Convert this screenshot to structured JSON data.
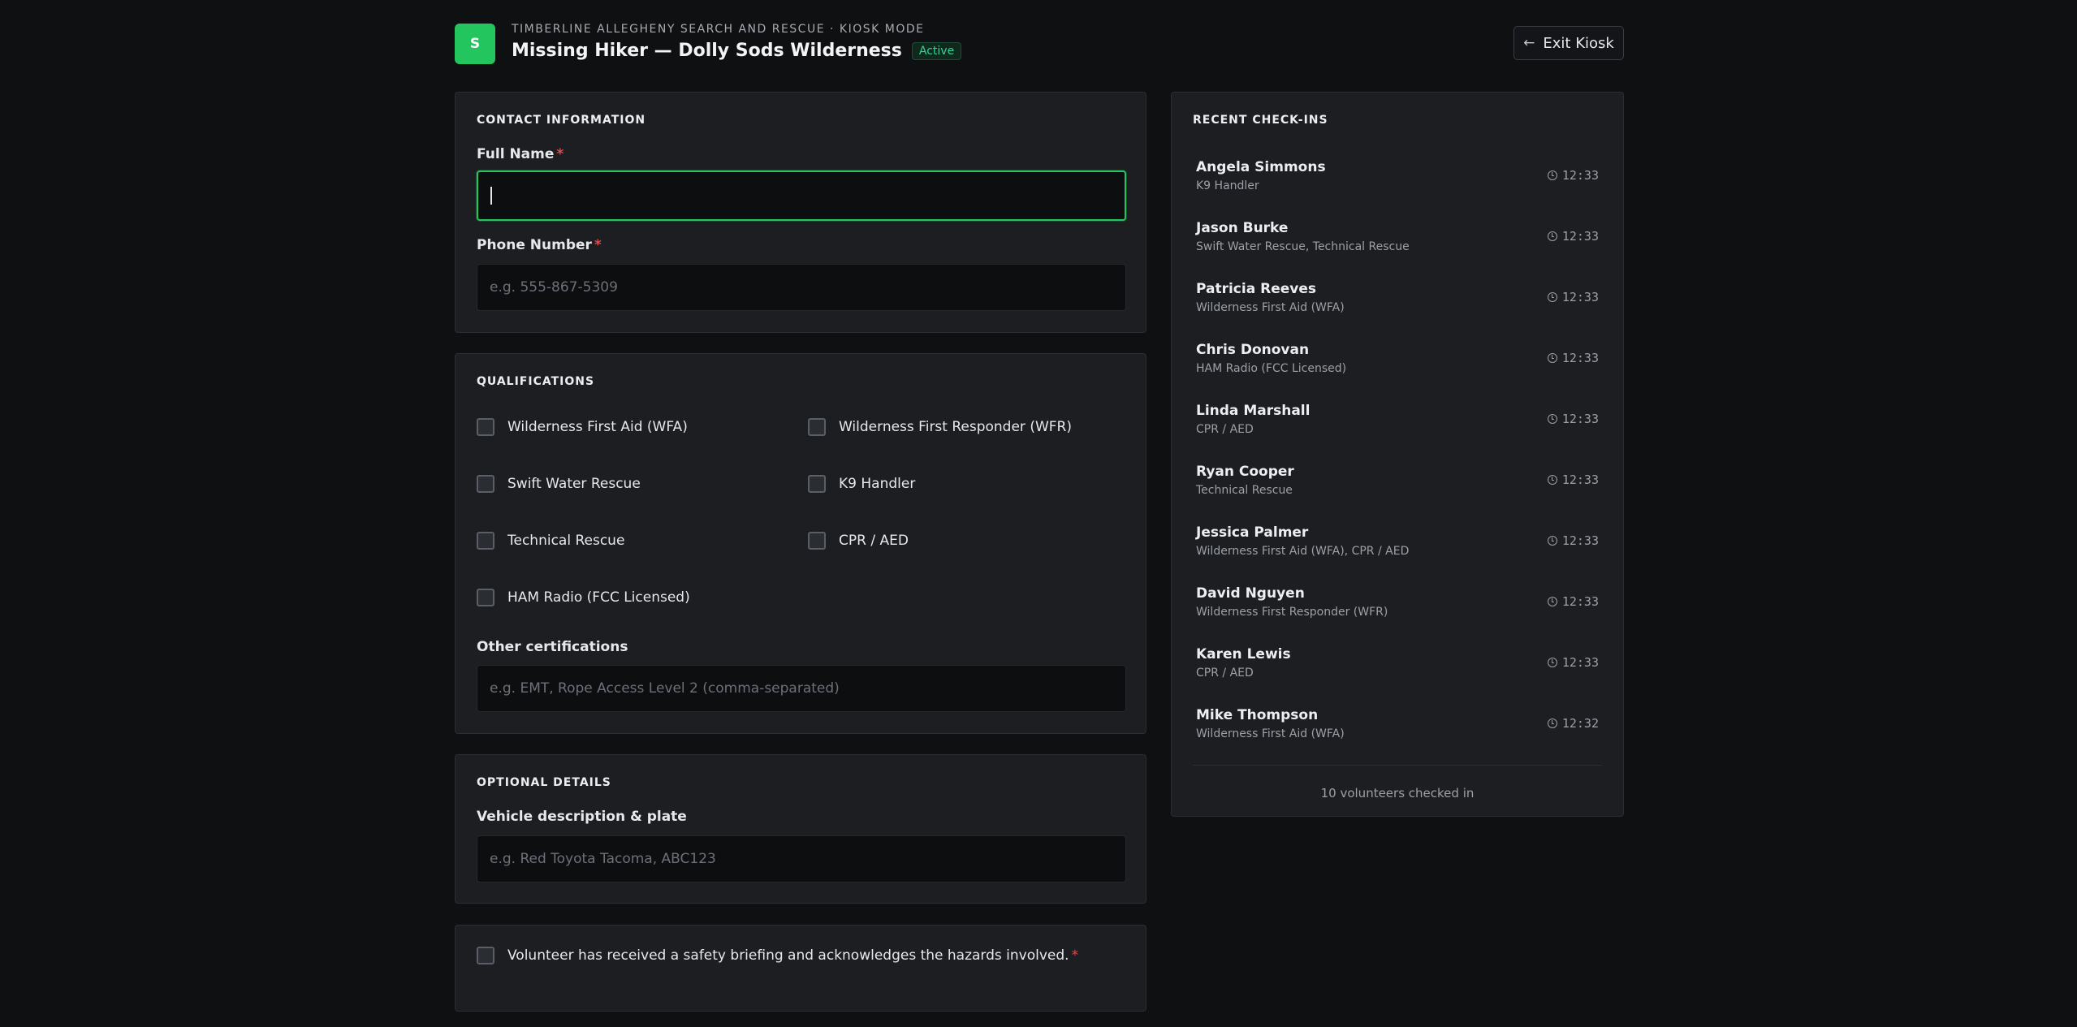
{
  "header": {
    "logo_letter": "S",
    "org": "TIMBERLINE ALLEGHENY SEARCH AND RESCUE · KIOSK MODE",
    "title": "Missing Hiker — Dolly Sods Wilderness",
    "status": "Active",
    "exit_label": "Exit Kiosk"
  },
  "contact": {
    "section_title": "CONTACT INFORMATION",
    "full_name_label": "Full Name",
    "full_name_value": "",
    "phone_label": "Phone Number",
    "phone_placeholder": "e.g. 555-867-5309",
    "required_mark": "*"
  },
  "qualifications": {
    "section_title": "QUALIFICATIONS",
    "items": [
      {
        "label": "Wilderness First Aid (WFA)",
        "checked": false
      },
      {
        "label": "Wilderness First Responder (WFR)",
        "checked": false
      },
      {
        "label": "Swift Water Rescue",
        "checked": false
      },
      {
        "label": "K9 Handler",
        "checked": false
      },
      {
        "label": "Technical Rescue",
        "checked": false
      },
      {
        "label": "CPR / AED",
        "checked": false
      },
      {
        "label": "HAM Radio (FCC Licensed)",
        "checked": false
      }
    ],
    "other_label": "Other certifications",
    "other_placeholder": "e.g. EMT, Rope Access Level 2 (comma-separated)"
  },
  "optional": {
    "section_title": "OPTIONAL DETAILS",
    "vehicle_label": "Vehicle description & plate",
    "vehicle_placeholder": "e.g. Red Toyota Tacoma, ABC123"
  },
  "briefing": {
    "label": "Volunteer has received a safety briefing and acknowledges the hazards involved.",
    "required_mark": "*",
    "checked": false
  },
  "checkins": {
    "section_title": "RECENT CHECK-INS",
    "items": [
      {
        "name": "Angela Simmons",
        "quals": "K9 Handler",
        "time": "12:33"
      },
      {
        "name": "Jason Burke",
        "quals": "Swift Water Rescue, Technical Rescue",
        "time": "12:33"
      },
      {
        "name": "Patricia Reeves",
        "quals": "Wilderness First Aid (WFA)",
        "time": "12:33"
      },
      {
        "name": "Chris Donovan",
        "quals": "HAM Radio (FCC Licensed)",
        "time": "12:33"
      },
      {
        "name": "Linda Marshall",
        "quals": "CPR / AED",
        "time": "12:33"
      },
      {
        "name": "Ryan Cooper",
        "quals": "Technical Rescue",
        "time": "12:33"
      },
      {
        "name": "Jessica Palmer",
        "quals": "Wilderness First Aid (WFA), CPR / AED",
        "time": "12:33"
      },
      {
        "name": "David Nguyen",
        "quals": "Wilderness First Responder (WFR)",
        "time": "12:33"
      },
      {
        "name": "Karen Lewis",
        "quals": "CPR / AED",
        "time": "12:33"
      },
      {
        "name": "Mike Thompson",
        "quals": "Wilderness First Aid (WFA)",
        "time": "12:32"
      }
    ],
    "footer": "10 volunteers checked in"
  },
  "colors": {
    "accent": "#22c55e",
    "background": "#0f1012",
    "card": "#1c1e22",
    "required": "#ef4444"
  }
}
